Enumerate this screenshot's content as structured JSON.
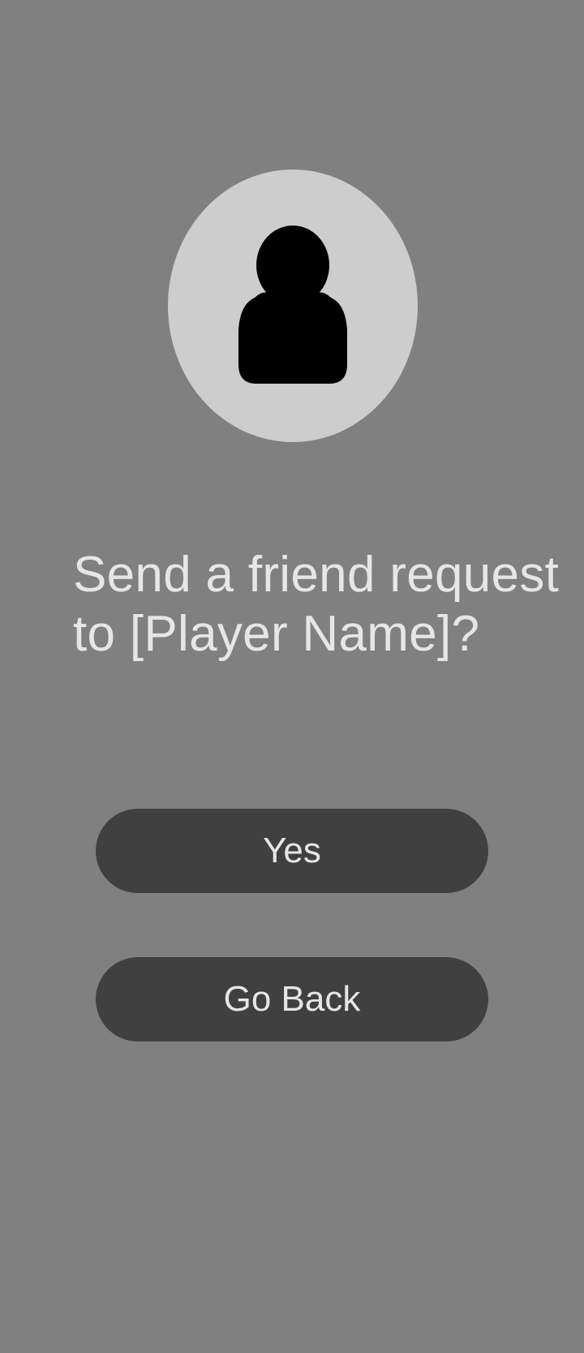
{
  "dialog": {
    "avatar_icon": "user-silhouette-icon",
    "prompt": "Send a friend request to [Player Name]?",
    "yes_label": "Yes",
    "back_label": "Go Back"
  },
  "colors": {
    "background": "#808080",
    "avatar_circle": "#cdcdcd",
    "button": "#404040",
    "text": "#e6e6e6"
  }
}
